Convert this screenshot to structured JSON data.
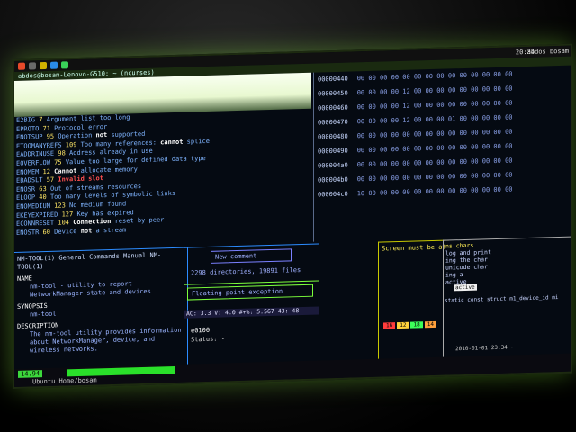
{
  "taskbar": {
    "clock": "20:34",
    "user": "abdos bosam"
  },
  "titlebar": {
    "title": "abdos@bosam-Lenovo-G510: ~ (ncurses)"
  },
  "errors": [
    {
      "code": "E2BIG",
      "num": "7",
      "msg": "Argument list too long"
    },
    {
      "code": "EPROTO",
      "num": "71",
      "msg": "Protocol error"
    },
    {
      "code": "ENOTSUP",
      "num": "95",
      "msg": "Operation not supported",
      "hl": "not"
    },
    {
      "code": "ETOOMANYREFS",
      "num": "109",
      "msg": "Too many references: cannot splice",
      "hl": "cannot"
    },
    {
      "code": "EADDRINUSE",
      "num": "98",
      "msg": "Address already in use"
    },
    {
      "code": "EOVERFLOW",
      "num": "75",
      "msg": "Value too large for defined data type"
    },
    {
      "code": "ENOMEM",
      "num": "12",
      "msg": "Cannot allocate memory",
      "hl": "Cannot"
    },
    {
      "code": "EBADSLT",
      "num": "57",
      "msg": "Invalid slot",
      "red": true
    },
    {
      "code": "ENOSR",
      "num": "63",
      "msg": "Out of streams resources"
    },
    {
      "code": "ELOOP",
      "num": "40",
      "msg": "Too many levels of symbolic links"
    },
    {
      "code": "ENOMEDIUM",
      "num": "123",
      "msg": "No medium found"
    },
    {
      "code": "EKEYEXPIRED",
      "num": "127",
      "msg": "Key has expired"
    },
    {
      "code": "ECONNRESET",
      "num": "104",
      "msg": "Connection reset by peer",
      "hl": "Connection"
    },
    {
      "code": "ENOSTR",
      "num": "60",
      "msg": "Device not a stream",
      "hl": "not"
    }
  ],
  "hex": [
    {
      "addr": "00000440",
      "bytes": "00 00 00 00 00 00 00 00  00 00 00 00 00 00"
    },
    {
      "addr": "00000450",
      "bytes": "00 00 00 00 12 00 00 00  00 00 00 00 00 00"
    },
    {
      "addr": "00000460",
      "bytes": "00 00 00 00 12 00 00 00  00 00 00 00 00 00"
    },
    {
      "addr": "00000470",
      "bytes": "00 00 00 00 12 00 00 00  01 00 00 00 00 00"
    },
    {
      "addr": "00000480",
      "bytes": "00 00 00 00 00 00 00 00  00 00 00 00 00 00"
    },
    {
      "addr": "00000490",
      "bytes": "00 00 00 00 00 00 00 00  00 00 00 00 00 00"
    },
    {
      "addr": "000004a0",
      "bytes": "00 00 00 00 00 00 00 00  00 00 00 00 00 00"
    },
    {
      "addr": "000004b0",
      "bytes": "00 00 00 00 00 00 00 00  00 00 00 00 00 00"
    },
    {
      "addr": "000004c0",
      "bytes": "10 00 00 00 00 00 00 00  00 00 00 00 00 00"
    }
  ],
  "man": {
    "head": "NM-TOOL(1)        General Commands Manual        NM-TOOL(1)",
    "name_title": "NAME",
    "name_body": "nm-tool - utility to report NetworkManager state and devices",
    "synopsis_title": "SYNOPSIS",
    "synopsis_body": "nm-tool",
    "desc_title": "DESCRIPTION",
    "desc_body": "The nm-tool utility provides information about NetworkManager, device, and wireless networks."
  },
  "mid": {
    "box1": "New comment",
    "box2": "2298 directories, 19891 files",
    "box3": "Floating point exception",
    "status": "AC: 3.3 V: 4.0 #+%: 5.567 43: 48",
    "prompt1": "e0100",
    "prompt2": "Status: -"
  },
  "right": {
    "a_text": "Screen must be at",
    "b_lines": [
      "ns chars",
      "log and print",
      "ing the char",
      "unicode char",
      "ing a",
      "active"
    ],
    "struct_line": "static const struct m1_device_id mi",
    "ok_label": "active"
  },
  "bottom": {
    "level": "14.94",
    "task": "Ubuntu Home/bosam"
  },
  "pills": [
    "16",
    "12",
    "18",
    "14"
  ],
  "clock2": "2010-01-01 23:34 -"
}
